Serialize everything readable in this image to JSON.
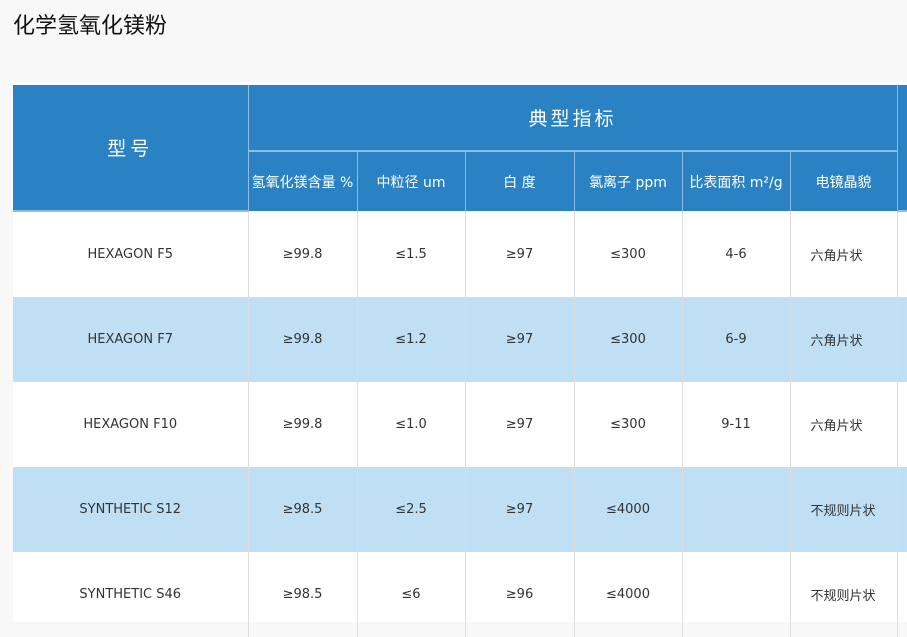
{
  "page_title": "化学氢氧化镁粉",
  "table": {
    "model_header": "型号",
    "group_header": "典型指标",
    "columns": [
      "氢氧化镁含量 %",
      "中粒径 um",
      "白 度",
      "氯离子 ppm",
      "比表面积 m²/g",
      "电镜晶貌"
    ],
    "rows": [
      {
        "model": "HEXAGON F5",
        "cells": [
          "≥99.8",
          "≤1.5",
          "≥97",
          "≤300",
          "4-6",
          "六角片状"
        ]
      },
      {
        "model": "HEXAGON F7",
        "cells": [
          "≥99.8",
          "≤1.2",
          "≥97",
          "≤300",
          "6-9",
          "六角片状"
        ]
      },
      {
        "model": "HEXAGON F10",
        "cells": [
          "≥99.8",
          "≤1.0",
          "≥97",
          "≤300",
          "9-11",
          "六角片状"
        ]
      },
      {
        "model": "SYNTHETIC S12",
        "cells": [
          "≥98.5",
          "≤2.5",
          "≥97",
          "≤4000",
          "",
          "不规则片状"
        ]
      },
      {
        "model": "SYNTHETIC S46",
        "cells": [
          "≥98.5",
          "≤6",
          "≥96",
          "≤4000",
          "",
          "不规则片状"
        ]
      }
    ]
  },
  "colors": {
    "header": "#2a82c2",
    "alt_row": "#bfe0f4"
  }
}
